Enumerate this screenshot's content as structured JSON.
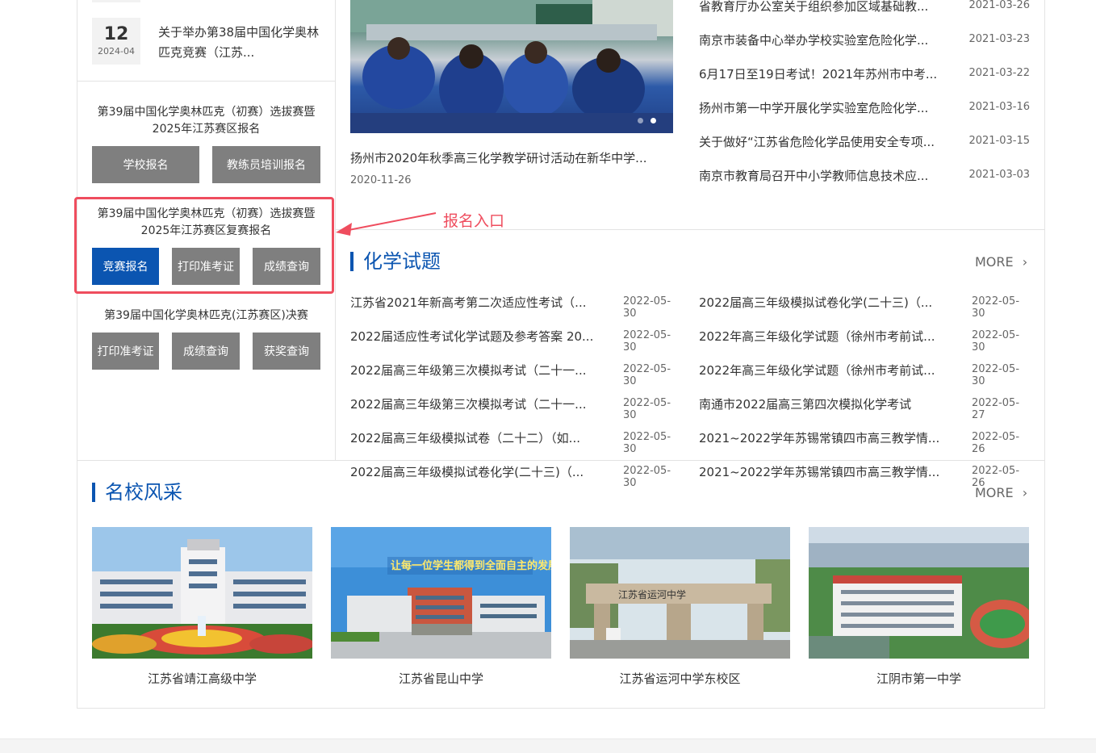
{
  "top_news": {
    "day": "12",
    "ym": "2024-04",
    "title": "关于举办第38届中国化学奥林匹克竞赛（江苏..."
  },
  "registration": {
    "block1": {
      "title": "第39届中国化学奥林匹克（初赛）选拔赛暨2025年江苏赛区报名",
      "buttons": [
        "学校报名",
        "教练员培训报名"
      ]
    },
    "block2": {
      "title": "第39届中国化学奥林匹克（初赛）选拔赛暨2025年江苏赛区复赛报名",
      "buttons": [
        "竞赛报名",
        "打印准考证",
        "成绩查询"
      ]
    },
    "block3": {
      "title": "第39届中国化学奥林匹克(江苏赛区)决赛",
      "buttons": [
        "打印准考证",
        "成绩查询",
        "获奖查询"
      ]
    }
  },
  "annotation": {
    "label": "报名入口",
    "color": "#ef4d5e"
  },
  "feature": {
    "caption": "扬州市2020年秋季高三化学教学研讨活动在新华中学...",
    "date": "2020-11-26"
  },
  "news": [
    {
      "title": "省教育厅办公室关于组织参加区域基础教...",
      "date": "2021-03-26"
    },
    {
      "title": "南京市装备中心举办学校实验室危险化学...",
      "date": "2021-03-23"
    },
    {
      "title": "6月17日至19日考试！2021年苏州市中考...",
      "date": "2021-03-22"
    },
    {
      "title": "扬州市第一中学开展化学实验室危险化学...",
      "date": "2021-03-16"
    },
    {
      "title": "关于做好“江苏省危险化学品使用安全专项...",
      "date": "2021-03-15"
    },
    {
      "title": "南京市教育局召开中小学教师信息技术应...",
      "date": "2021-03-03"
    }
  ],
  "questions": {
    "title": "化学试题",
    "more": "MORE",
    "left": [
      {
        "title": "江苏省2021年新高考第二次适应性考试（...",
        "date": "2022-05-30"
      },
      {
        "title": "2022届适应性考试化学试题及参考答案 20...",
        "date": "2022-05-30"
      },
      {
        "title": "2022届高三年级第三次模拟考试（二十一...",
        "date": "2022-05-30"
      },
      {
        "title": "2022届高三年级第三次模拟考试（二十一...",
        "date": "2022-05-30"
      },
      {
        "title": "2022届高三年级模拟试卷（二十二）（如...",
        "date": "2022-05-30"
      },
      {
        "title": "2022届高三年级模拟试卷化学(二十三)（...",
        "date": "2022-05-30"
      }
    ],
    "right": [
      {
        "title": "2022届高三年级模拟试卷化学(二十三)（...",
        "date": "2022-05-30"
      },
      {
        "title": "2022年高三年级化学试题（徐州市考前试...",
        "date": "2022-05-30"
      },
      {
        "title": "2022年高三年级化学试题（徐州市考前试...",
        "date": "2022-05-30"
      },
      {
        "title": "南通市2022届高三第四次模拟化学考试",
        "date": "2022-05-27"
      },
      {
        "title": "2021~2022学年苏锡常镇四市高三教学情...",
        "date": "2022-05-26"
      },
      {
        "title": "2021~2022学年苏锡常镇四市高三教学情...",
        "date": "2022-05-26"
      }
    ]
  },
  "schools": {
    "title": "名校风采",
    "more": "MORE",
    "items": [
      {
        "name": "江苏省靖江高级中学"
      },
      {
        "name": "江苏省昆山中学",
        "banner": "让每一位学生都得到全面自主的发展"
      },
      {
        "name": "江苏省运河中学东校区",
        "gate_text": "江苏省运河中学"
      },
      {
        "name": "江阴市第一中学"
      }
    ]
  },
  "colors": {
    "accent": "#0b55b1",
    "button_gray": "#7f7f7f",
    "annotation_red": "#ef4d5e"
  }
}
